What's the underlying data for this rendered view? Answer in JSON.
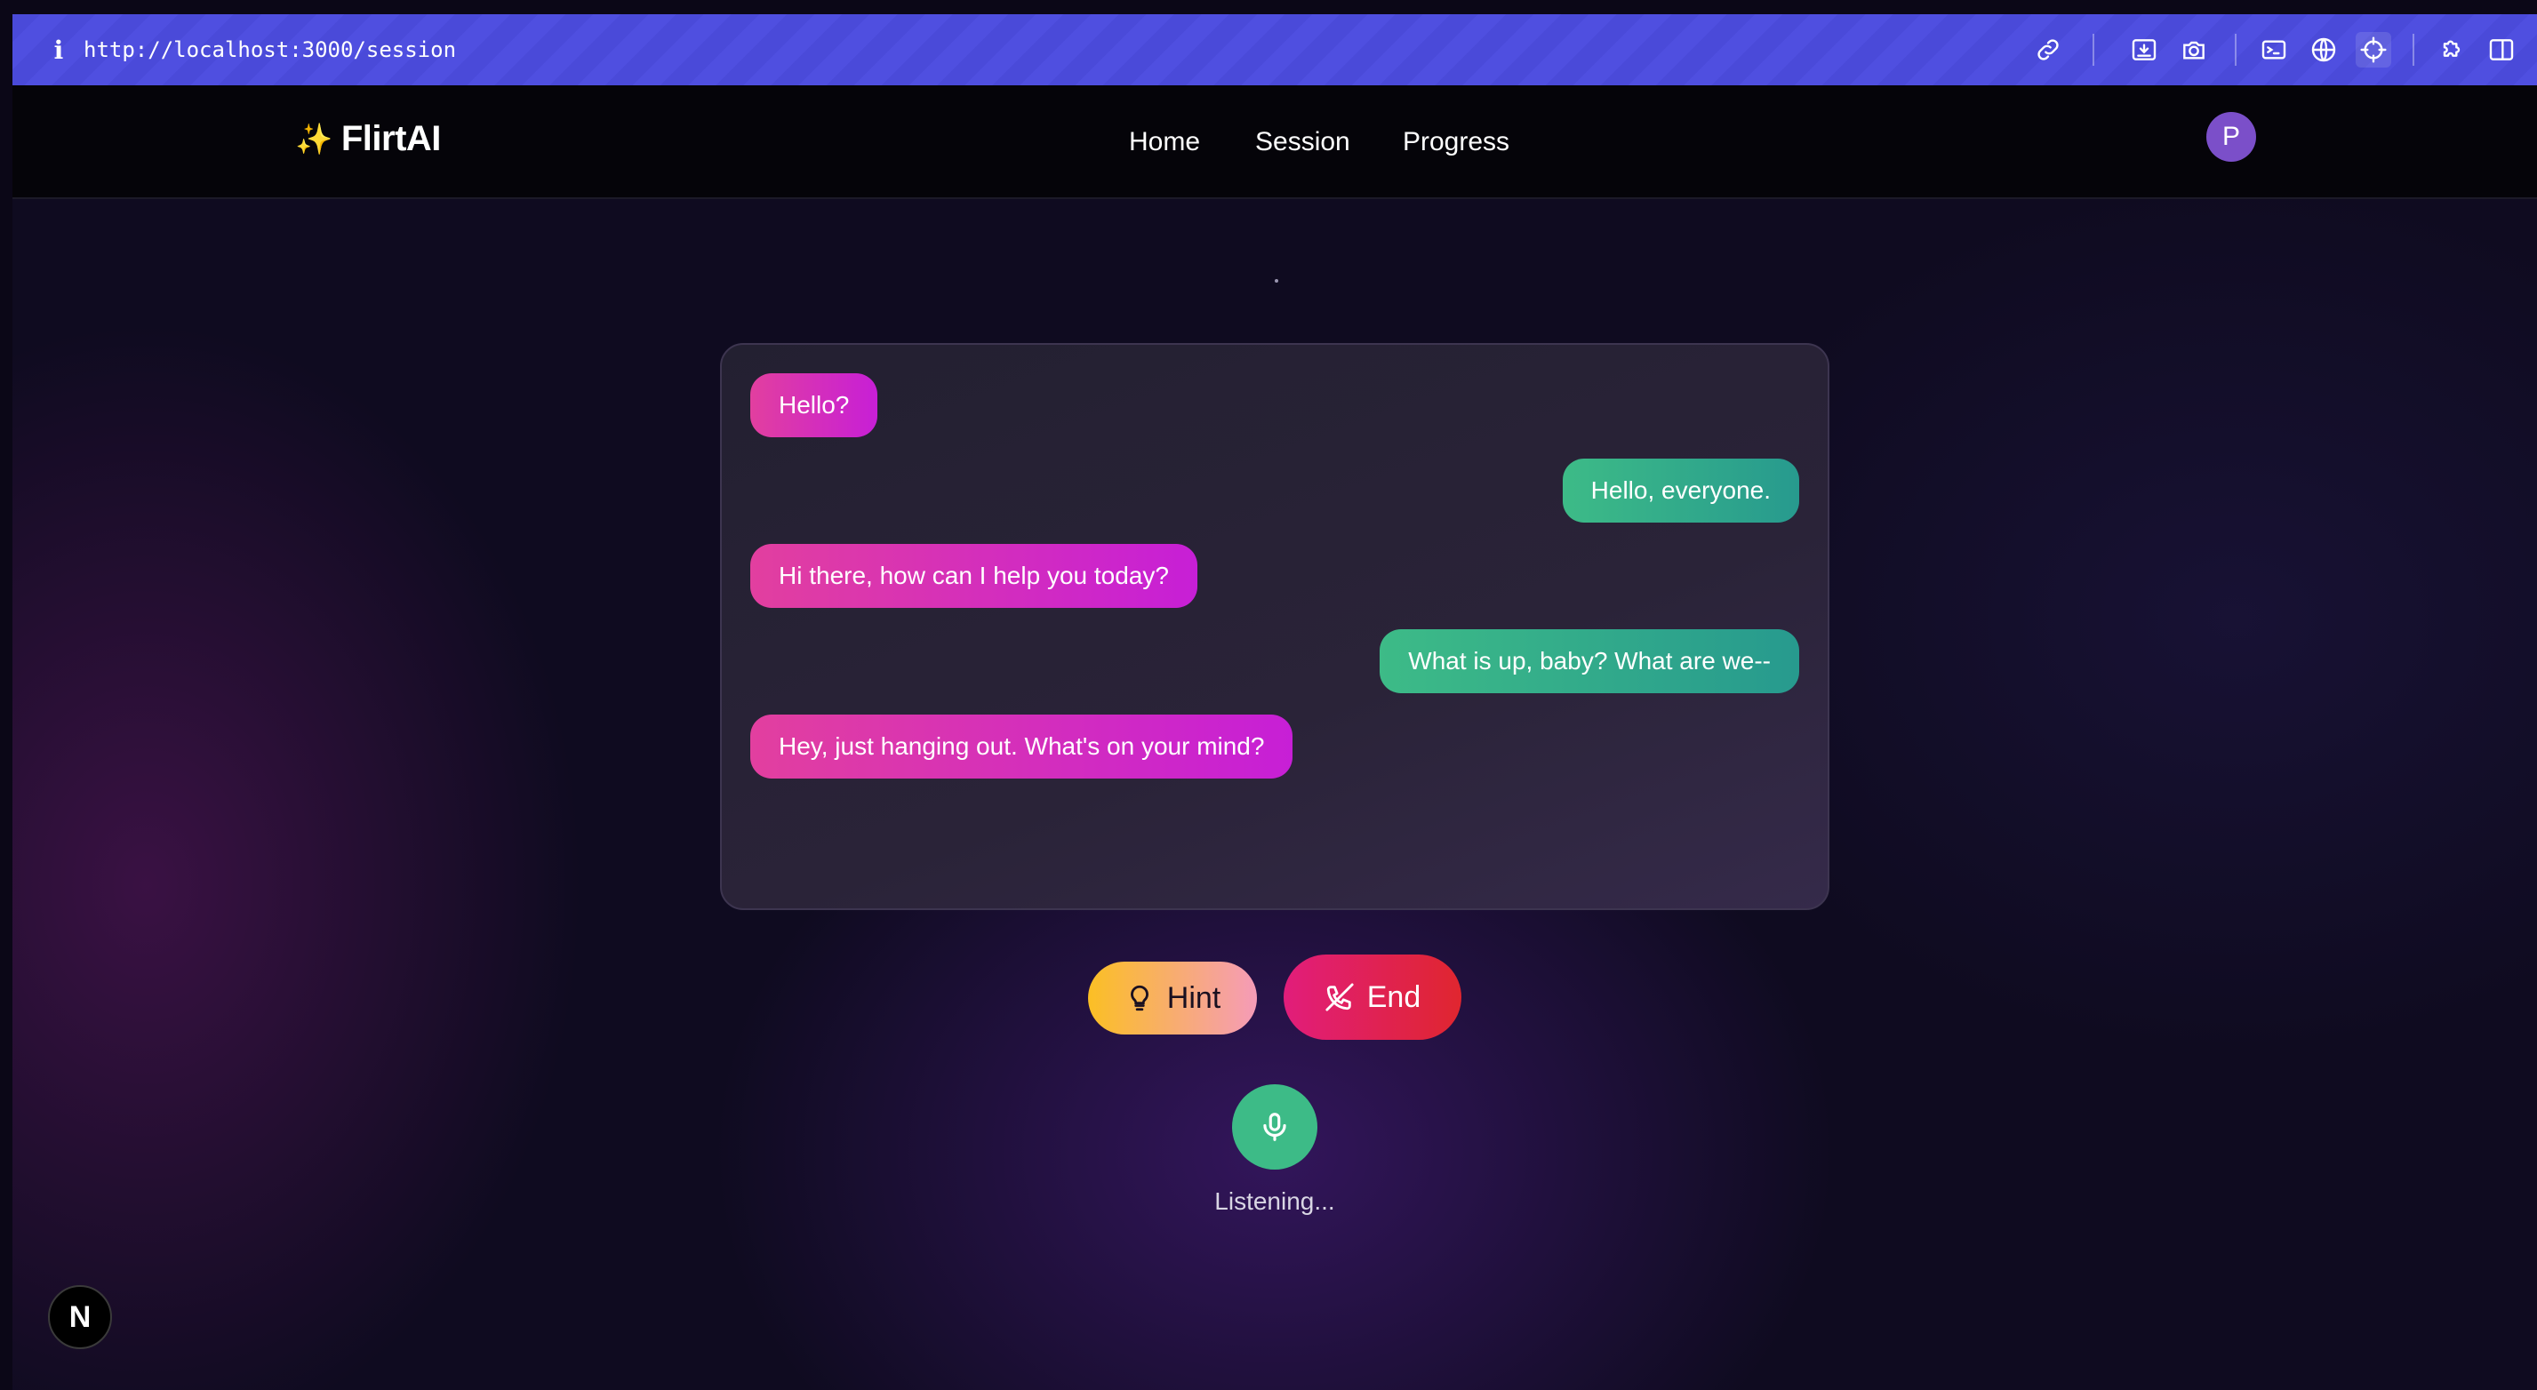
{
  "browser": {
    "url": "http://localhost:3000/session",
    "info_icon": "i"
  },
  "nav": {
    "brand_icon": "✨",
    "brand_name": "FlirtAI",
    "links": [
      "Home",
      "Session",
      "Progress"
    ],
    "avatar_initial": "P"
  },
  "chat": {
    "messages": [
      {
        "role": "ai",
        "text": "Hello?"
      },
      {
        "role": "user",
        "text": "Hello, everyone."
      },
      {
        "role": "ai",
        "text": "Hi there, how can I help you today?"
      },
      {
        "role": "user",
        "text": "What is up, baby? What are we--"
      },
      {
        "role": "ai",
        "text": "Hey, just hanging out. What's on your mind?"
      }
    ]
  },
  "controls": {
    "hint_label": "Hint",
    "end_label": "End",
    "status": "Listening..."
  },
  "dev_badge": "N",
  "colors": {
    "toolbar": "#4a4ad9",
    "ai_bubble_start": "#e23f9f",
    "ai_bubble_end": "#c71fd6",
    "user_bubble_start": "#3dbb87",
    "user_bubble_end": "#279a8e",
    "hint_start": "#fbbf24",
    "end_start": "#e11d7b",
    "mic": "#3dbb87",
    "avatar": "#7b4fc9"
  },
  "icons": {
    "toolbar": [
      "link-icon",
      "download-icon",
      "camera-icon",
      "terminal-icon",
      "globe-icon",
      "crosshair-icon",
      "puzzle-icon",
      "sidebar-icon"
    ],
    "hint": "lightbulb-icon",
    "end": "phone-off-icon",
    "mic": "microphone-icon"
  }
}
